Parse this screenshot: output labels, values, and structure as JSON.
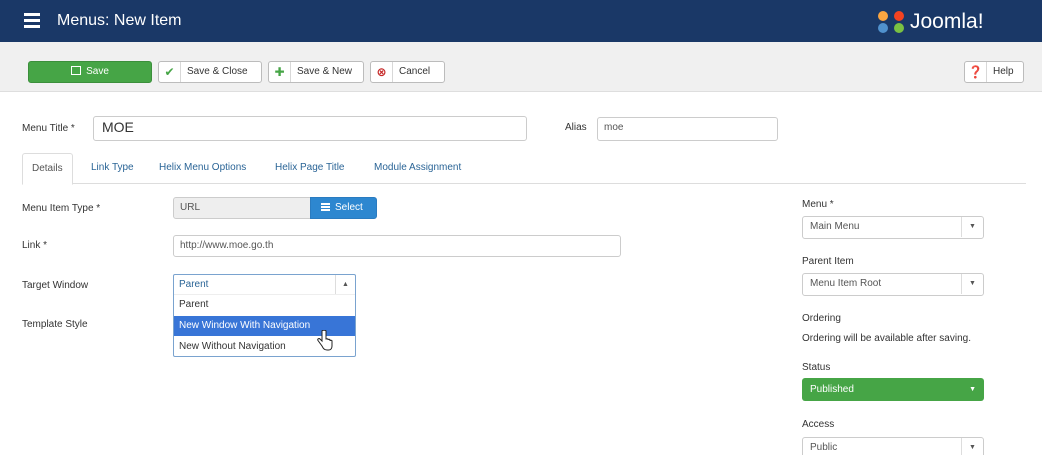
{
  "header": {
    "title": "Menus: New Item",
    "logo_text": "Joomla!"
  },
  "toolbar": {
    "save_label": "Save",
    "save_close_label": "Save & Close",
    "save_new_label": "Save & New",
    "cancel_label": "Cancel",
    "help_label": "Help"
  },
  "form": {
    "menu_title_label": "Menu Title *",
    "menu_title_value": "MOE",
    "alias_label": "Alias",
    "alias_value": "moe"
  },
  "tabs": [
    "Details",
    "Link Type",
    "Helix Menu Options",
    "Helix Page Title",
    "Module Assignment"
  ],
  "details": {
    "menu_item_type_label": "Menu Item Type *",
    "menu_item_type_value": "URL",
    "select_button_label": "Select",
    "link_label": "Link *",
    "link_value": "http://www.moe.go.th",
    "target_window_label": "Target Window",
    "target_window_value": "Parent",
    "target_window_options": [
      "Parent",
      "New Window With Navigation",
      "New Without Navigation"
    ],
    "template_style_label": "Template Style"
  },
  "sidebar": {
    "menu_label": "Menu *",
    "menu_value": "Main Menu",
    "parent_item_label": "Parent Item",
    "parent_item_value": "Menu Item Root",
    "ordering_label": "Ordering",
    "ordering_note": "Ordering will be available after saving.",
    "status_label": "Status",
    "status_value": "Published",
    "access_label": "Access",
    "access_value": "Public"
  },
  "colors": {
    "header_bg": "#1a3867",
    "save_green": "#46a546",
    "select_blue": "#2d87d0",
    "highlight_blue": "#3875d7"
  },
  "icons": {
    "header_menu": "list-icon",
    "save": "edit-icon",
    "save_close": "check-icon",
    "save_new": "plus-icon",
    "cancel": "cancel-circle-icon",
    "help": "question-circle-icon",
    "select": "list-icon",
    "cursor": "hand-pointer-icon"
  }
}
